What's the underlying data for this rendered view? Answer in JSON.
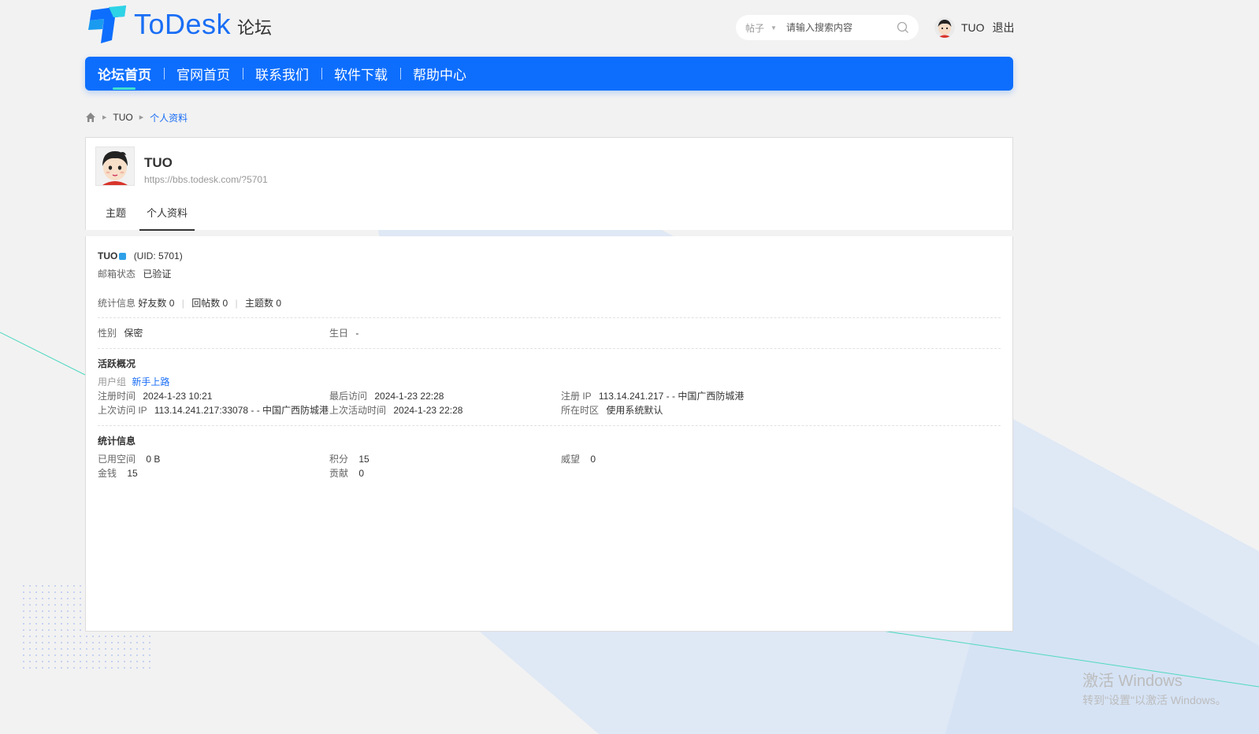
{
  "header": {
    "logo_text": "ToDesk",
    "logo_sub": "论坛",
    "search": {
      "type_label": "帖子",
      "placeholder": "请输入搜索内容"
    },
    "user": {
      "name": "TUO",
      "logout_label": "退出"
    }
  },
  "nav": {
    "items": [
      {
        "label": "论坛首页",
        "active": true
      },
      {
        "label": "官网首页"
      },
      {
        "label": "联系我们"
      },
      {
        "label": "软件下载"
      },
      {
        "label": "帮助中心"
      }
    ]
  },
  "breadcrumb": {
    "items": [
      "TUO",
      "个人资料"
    ]
  },
  "profile": {
    "name": "TUO",
    "url": "https://bbs.todesk.com/?5701",
    "tabs": [
      {
        "label": "主题"
      },
      {
        "label": "个人资料",
        "active": true
      }
    ]
  },
  "info": {
    "username": "TUO",
    "uid": "(UID: 5701)",
    "email_label": "邮箱状态",
    "email_value": "已验证",
    "stats_label": "统计信息",
    "friends": "好友数 0",
    "replies": "回帖数 0",
    "threads": "主题数 0",
    "gender_label": "性别",
    "gender_value": "保密",
    "birthday_label": "生日",
    "birthday_value": "-"
  },
  "activity": {
    "title": "活跃概况",
    "group_label": "用户组",
    "group_value": "新手上路",
    "reg_time_label": "注册时间",
    "reg_time_value": "2024-1-23 10:21",
    "last_visit_label": "最后访问",
    "last_visit_value": "2024-1-23 22:28",
    "reg_ip_label": "注册 IP",
    "reg_ip_value": "113.14.241.217 - - 中国广西防城港",
    "last_ip_label": "上次访问 IP",
    "last_ip_value": "113.14.241.217:33078 - - 中国广西防城港",
    "last_active_label": "上次活动时间",
    "last_active_value": "2024-1-23 22:28",
    "timezone_label": "所在时区",
    "timezone_value": "使用系统默认"
  },
  "statistics": {
    "title": "统计信息",
    "space_label": "已用空间",
    "space_value": "0 B",
    "points_label": "积分",
    "points_value": "15",
    "prestige_label": "威望",
    "prestige_value": "0",
    "money_label": "金钱",
    "money_value": "15",
    "contrib_label": "贡献",
    "contrib_value": "0"
  },
  "watermark": {
    "line1": "激活 Windows",
    "line2": "转到\"设置\"以激活 Windows。"
  },
  "colors": {
    "brand": "#0d6efd",
    "link": "#1a6ef5",
    "nav_indicator": "#3ee0d0"
  }
}
